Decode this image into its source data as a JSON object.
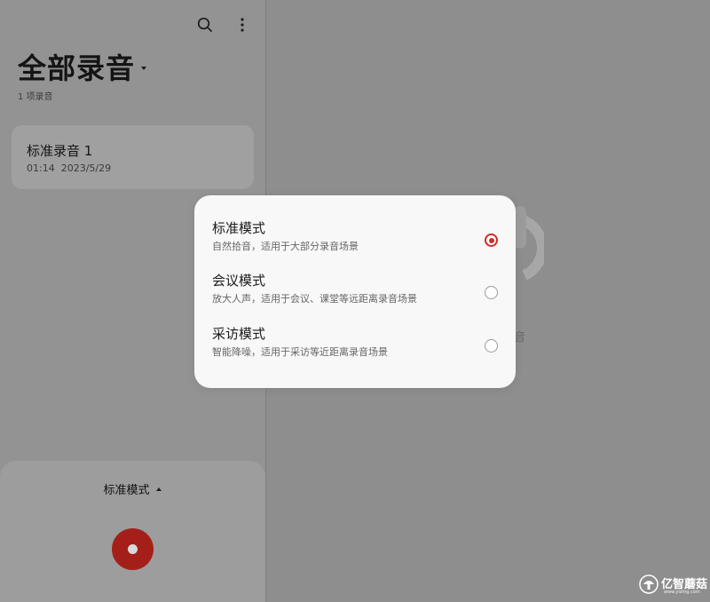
{
  "header": {
    "title": "全部录音",
    "count": "1 项录音",
    "search_icon": "search-icon",
    "more_icon": "more-vertical-icon"
  },
  "recordings": [
    {
      "name": "标准录音 1",
      "duration": "01:14",
      "date": "2023/5/29"
    }
  ],
  "bottom_panel": {
    "mode_label": "标准模式",
    "record_icon": "record-icon"
  },
  "empty_state": {
    "text_fragment": "音"
  },
  "mode_dialog": {
    "options": [
      {
        "title": "标准模式",
        "description": "自然拾音，适用于大部分录音场景",
        "selected": true
      },
      {
        "title": "会议模式",
        "description": "放大人声，适用于会议、课堂等远距离录音场景",
        "selected": false
      },
      {
        "title": "采访模式",
        "description": "智能降噪，适用于采访等近距离录音场景",
        "selected": false
      }
    ]
  },
  "watermark": {
    "text": "亿智蘑菇",
    "url": "www.yizmg.com"
  },
  "colors": {
    "accent": "#d22a25",
    "record_button": "#a51f1a"
  }
}
